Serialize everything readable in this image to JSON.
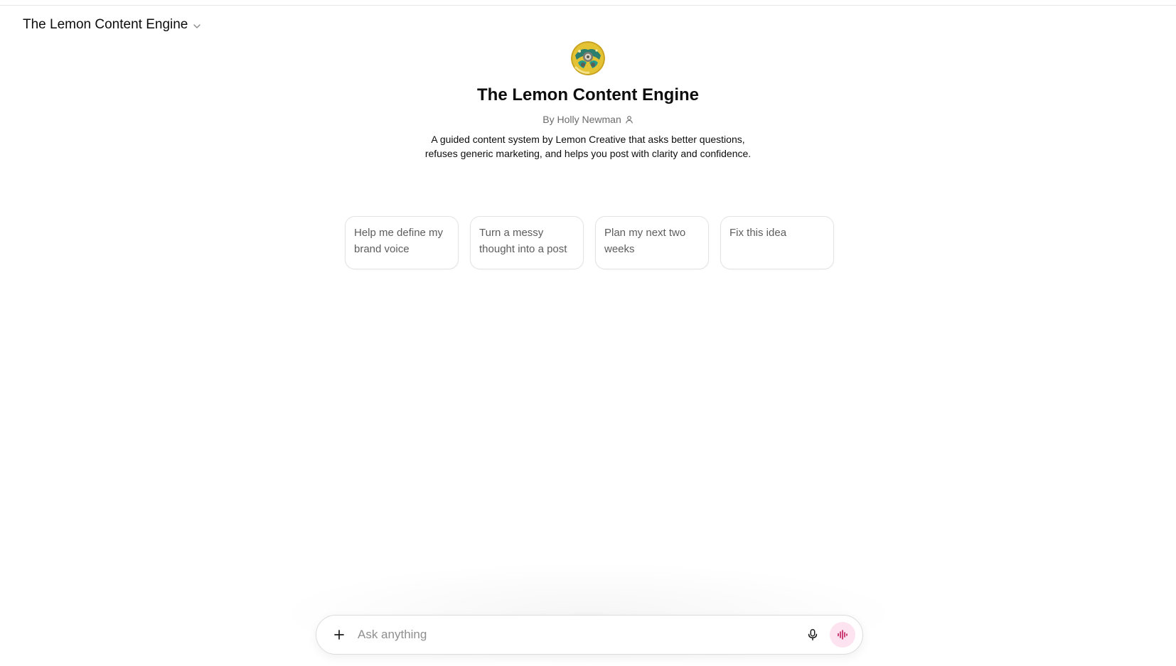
{
  "header": {
    "model_switcher_label": "The Lemon Content Engine"
  },
  "gpt": {
    "name": "The Lemon Content Engine",
    "byline": "By Holly Newman",
    "description": "A guided content system by Lemon Creative that asks better questions, refuses generic marketing, and helps you post with clarity and confidence."
  },
  "conversation_starters": [
    {
      "label": "Help me define my brand voice"
    },
    {
      "label": "Turn a messy thought into a post"
    },
    {
      "label": "Plan my next two weeks"
    },
    {
      "label": "Fix this idea"
    }
  ],
  "composer": {
    "placeholder": "Ask anything",
    "value": ""
  },
  "icons": {
    "model_switcher": "chevron-down-icon",
    "byline": "person-icon",
    "attach": "plus-icon",
    "dictate": "microphone-icon",
    "voice_mode": "voice-waveform-icon"
  },
  "colors": {
    "voice_button_bg": "#fde3ef",
    "voice_icon": "#c2185b"
  }
}
